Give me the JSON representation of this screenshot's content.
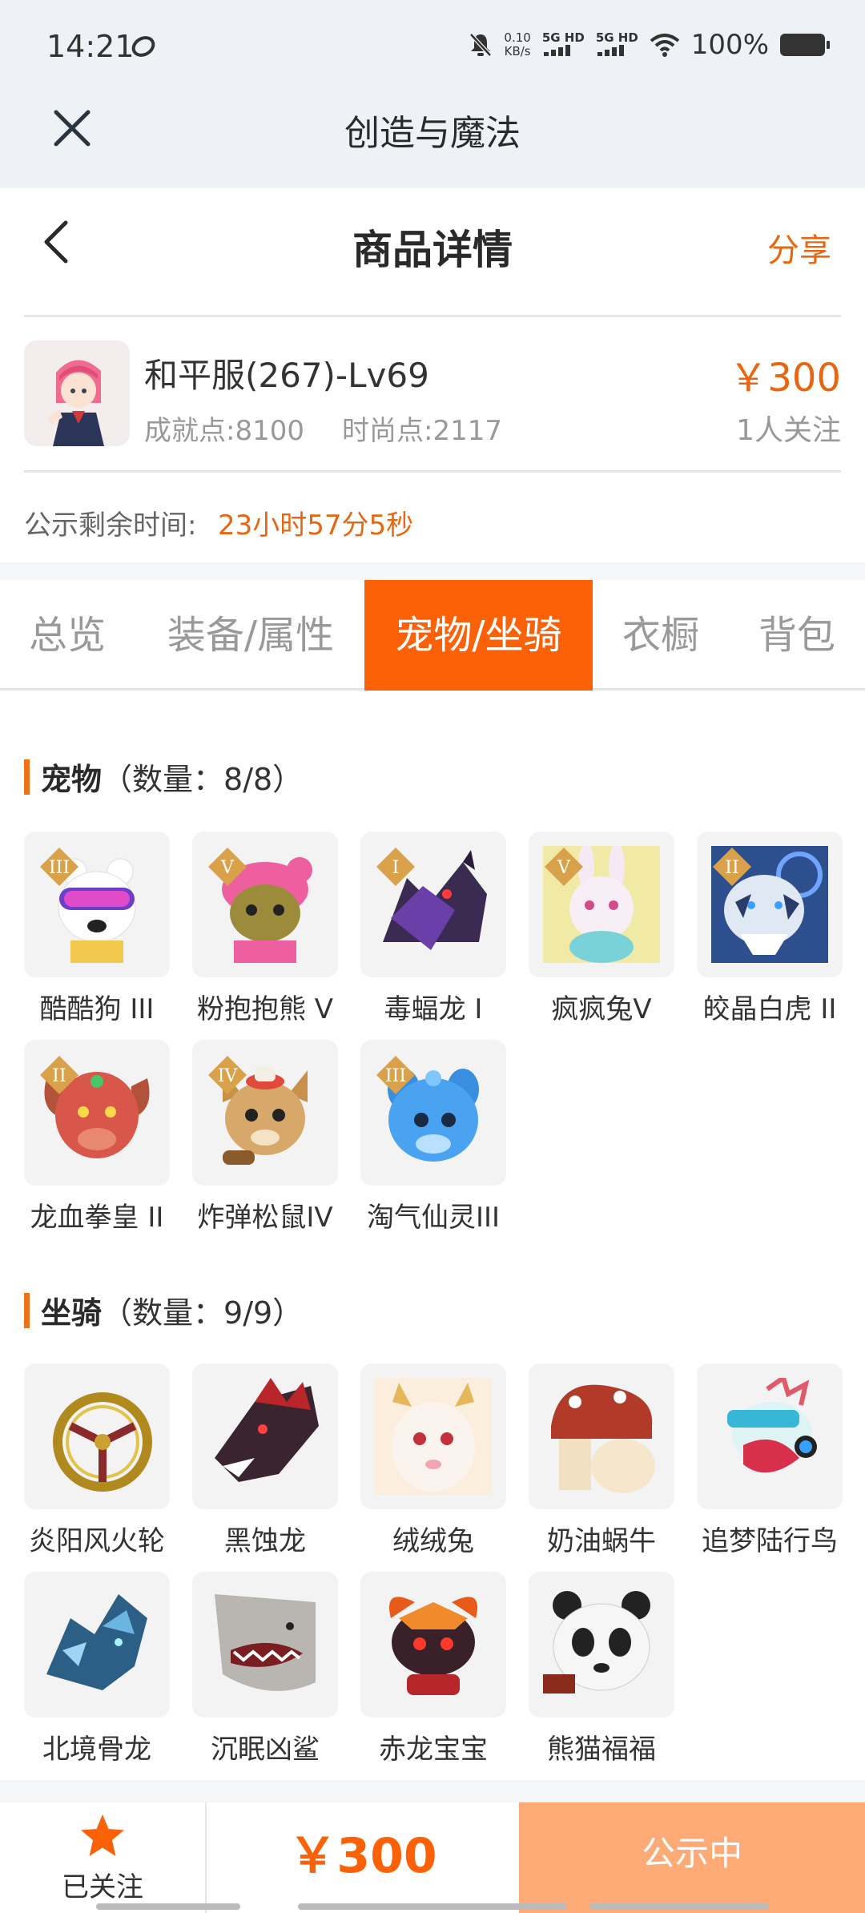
{
  "status_bar": {
    "time": "14:21",
    "speed_value": "0.10",
    "speed_unit": "KB/s",
    "network_1": "5G HD",
    "network_2": "5G HD",
    "battery": "100%"
  },
  "app_bar": {
    "title": "创造与魔法",
    "close_icon": "close-icon"
  },
  "header": {
    "title": "商品详情",
    "share_label": "分享",
    "back_icon": "chevron-left-icon"
  },
  "item": {
    "name": "和平服(267)-Lv69",
    "achievement": "成就点:8100",
    "fashion": "时尚点:2117",
    "price": "￥300",
    "followers": "1人关注"
  },
  "countdown": {
    "label": "公示剩余时间:",
    "value": "23小时57分5秒"
  },
  "tabs": [
    {
      "label": "总览",
      "active": false
    },
    {
      "label": "装备/属性",
      "active": false
    },
    {
      "label": "宠物/坐骑",
      "active": true
    },
    {
      "label": "衣橱",
      "active": false
    },
    {
      "label": "背包",
      "active": false
    }
  ],
  "pets": {
    "title": "宠物",
    "count": "（数量：8/8）",
    "items": [
      {
        "name": "酷酷狗 III",
        "grade": "III"
      },
      {
        "name": "粉抱抱熊 V",
        "grade": "V"
      },
      {
        "name": "毒蝠龙 I",
        "grade": "I"
      },
      {
        "name": "疯疯兔V",
        "grade": "V"
      },
      {
        "name": "皎晶白虎 II",
        "grade": "II"
      },
      {
        "name": "龙血拳皇 II",
        "grade": "II"
      },
      {
        "name": "炸弹松鼠IV",
        "grade": "IV"
      },
      {
        "name": "淘气仙灵III",
        "grade": "III"
      }
    ]
  },
  "mounts": {
    "title": "坐骑",
    "count": "（数量：9/9）",
    "items": [
      {
        "name": "炎阳风火轮"
      },
      {
        "name": "黑蚀龙"
      },
      {
        "name": "绒绒兔"
      },
      {
        "name": "奶油蜗牛"
      },
      {
        "name": "追梦陆行鸟"
      },
      {
        "name": "北境骨龙"
      },
      {
        "name": "沉眠凶鲨"
      },
      {
        "name": "赤龙宝宝"
      },
      {
        "name": "熊猫福福"
      }
    ]
  },
  "bottom_bar": {
    "follow_label": "已关注",
    "price": "￥300",
    "status_label": "公示中"
  },
  "colors": {
    "accent": "#fb6208",
    "accent_light": "#fdaa76",
    "price": "#e8660f"
  }
}
